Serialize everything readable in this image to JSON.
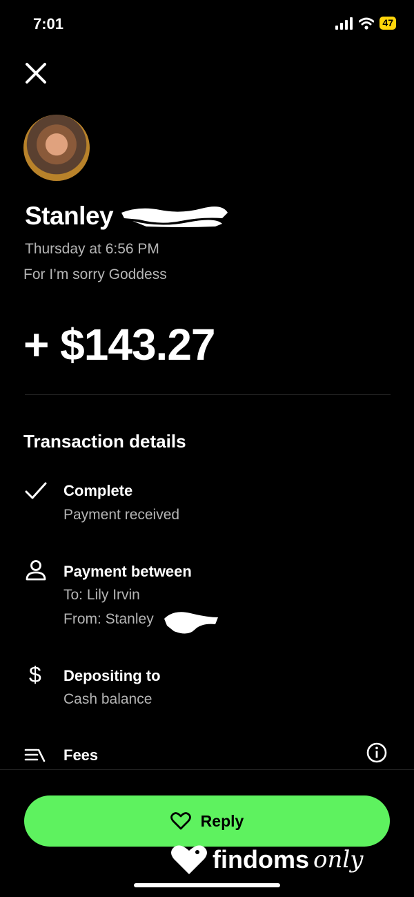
{
  "status_bar": {
    "time": "7:01",
    "battery": "47"
  },
  "header": {
    "close_icon": "close-icon"
  },
  "sender": {
    "name": "Stanley",
    "date": "Thursday at 6:56 PM",
    "note": "For I’m sorry Goddess"
  },
  "amount": "+ $143.27",
  "transaction": {
    "title": "Transaction details",
    "status_title": "Complete",
    "status_sub": "Payment received",
    "between_title": "Payment between",
    "to": "To: Lily Irvin",
    "from": "From: Stanley",
    "deposit_title": "Depositing to",
    "deposit_sub": "Cash balance",
    "fees_title": "Fees"
  },
  "reply_button": {
    "label": "Reply"
  },
  "watermark": {
    "bold": "findoms",
    "script": "only"
  },
  "colors": {
    "accent": "#5ef25f",
    "background": "#000000",
    "battery": "#ffd60a"
  }
}
